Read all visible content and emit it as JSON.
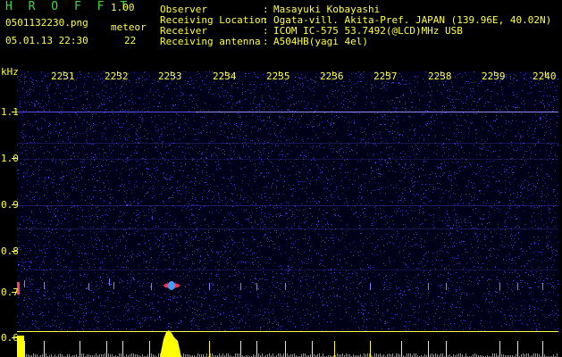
{
  "app": {
    "logo": "H R O F F T",
    "version": "1.00"
  },
  "capture": {
    "filename": "0501132230.png",
    "timestamp": "05.01.13 22:30"
  },
  "meteor": {
    "label": "meteor",
    "count": "22"
  },
  "info": [
    {
      "key": "Observer",
      "value": "Masayuki Kobayashi"
    },
    {
      "key": "Receiving Location",
      "value": "Ogata-vill. Akita-Pref. JAPAN (139.96E, 40.02N)"
    },
    {
      "key": "Receiver",
      "value": "ICOM IC-575 53.7492(@LCD)MHz USB"
    },
    {
      "key": "Receiving antenna",
      "value": "A504HB(yagi 4el)"
    }
  ],
  "axis": {
    "unit": "kHz",
    "time_ticks": [
      "2231",
      "2232",
      "2233",
      "2234",
      "2235",
      "2236",
      "2237",
      "2238",
      "2239",
      "2240"
    ],
    "freq_ticks": [
      "1.1",
      "1.0",
      "0.9",
      "0.8",
      "0.7",
      "0.6"
    ]
  },
  "colors": {
    "text": "#ffff40",
    "logo": "#3fdc3f",
    "background": "#000018",
    "noise": "#3a3aff",
    "echo_bar": "#ffff00"
  }
}
